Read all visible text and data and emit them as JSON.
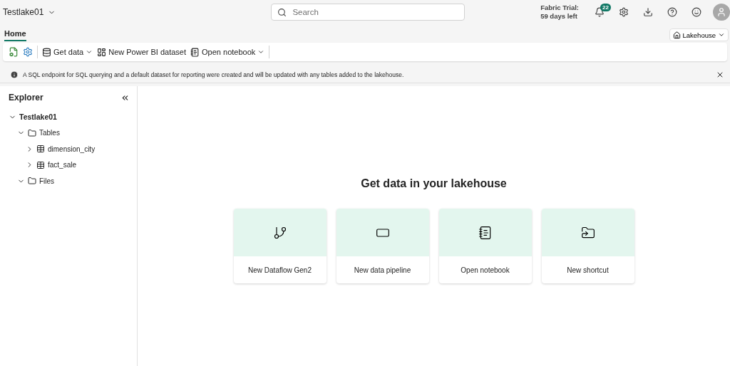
{
  "header": {
    "workspace": "Testlake01",
    "search": {
      "placeholder": "Search"
    },
    "trial": [
      "Fabric Trial:",
      "59 days left"
    ],
    "notifications": "22"
  },
  "tabs": [
    {
      "label": "Home",
      "selected": true
    }
  ],
  "view_switch": "Lakehouse",
  "ribbon": [
    {
      "kind": "refresh-icon"
    },
    {
      "kind": "settings-icon"
    },
    {
      "kind": "get-data",
      "label": "Get data",
      "dropdown": true
    },
    {
      "kind": "dataset",
      "label": "New Power BI dataset",
      "dropdown": false
    },
    {
      "kind": "notebook",
      "label": "Open notebook",
      "dropdown": true
    }
  ],
  "banner": "A SQL endpoint for SQL querying and a default dataset for reporting were created and will be updated with any tables added to the lakehouse.",
  "explorer": {
    "title": "Explorer",
    "tree": [
      {
        "label": "Testlake01",
        "kind": "root",
        "expanded": true,
        "children": [
          {
            "label": "Tables",
            "kind": "folder",
            "expanded": true,
            "children": [
              {
                "label": "dimension_city",
                "kind": "table",
                "expanded": false
              },
              {
                "label": "fact_sale",
                "kind": "table",
                "expanded": false
              }
            ]
          },
          {
            "label": "Files",
            "kind": "folder",
            "expanded": true
          }
        ]
      }
    ]
  },
  "main": {
    "title": "Get data in your lakehouse",
    "cards": [
      {
        "label": "New Dataflow Gen2",
        "kind": "dataflow"
      },
      {
        "label": "New data pipeline",
        "kind": "pipeline"
      },
      {
        "label": "Open notebook",
        "kind": "notebook"
      },
      {
        "label": "New shortcut",
        "kind": "shortcut"
      }
    ]
  }
}
